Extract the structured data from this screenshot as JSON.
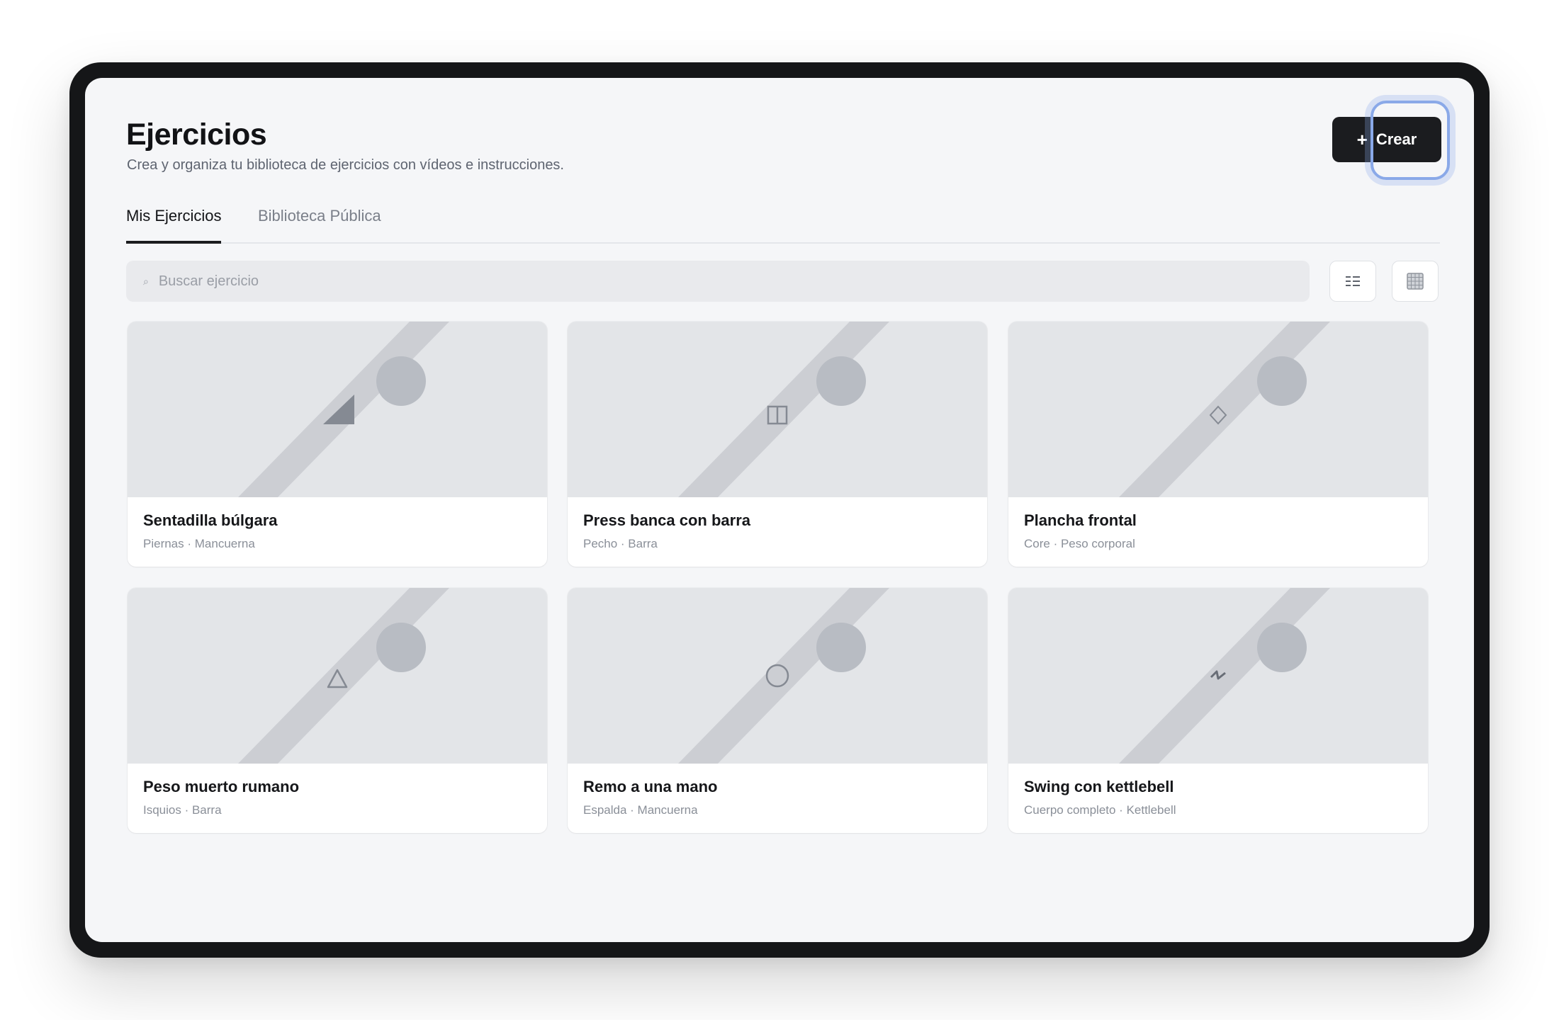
{
  "header": {
    "title": "Ejercicios",
    "subtitle": "Crea y organiza tu biblioteca de ejercicios con vídeos e instrucciones.",
    "create_label": "Crear"
  },
  "tabs": [
    {
      "label": "Mis Ejercicios",
      "active": true
    },
    {
      "label": "Biblioteca Pública",
      "active": false
    }
  ],
  "search": {
    "placeholder": "Buscar ejercicio"
  },
  "view_toggle": [
    "list-icon",
    "grid-icon"
  ],
  "exercises": [
    {
      "name": "Sentadilla búlgara",
      "meta": "Piernas · Mancuerna",
      "icon": "wedge-icon"
    },
    {
      "name": "Press banca con barra",
      "meta": "Pecho · Barra",
      "icon": "split-square-icon"
    },
    {
      "name": "Plancha frontal",
      "meta": "Core · Peso corporal",
      "icon": "diamond-icon"
    },
    {
      "name": "Peso muerto rumano",
      "meta": "Isquios · Barra",
      "icon": "triangle-icon"
    },
    {
      "name": "Remo a una mano",
      "meta": "Espalda · Mancuerna",
      "icon": "circle-icon"
    },
    {
      "name": "Swing con kettlebell",
      "meta": "Cuerpo completo · Kettlebell",
      "icon": "bolt-icon"
    }
  ],
  "colors": {
    "primary_button": "#1b1c1f",
    "focus_ring": "#8aa9e8",
    "background": "#f5f6f8",
    "thumbnail": "#e3e5e8"
  }
}
